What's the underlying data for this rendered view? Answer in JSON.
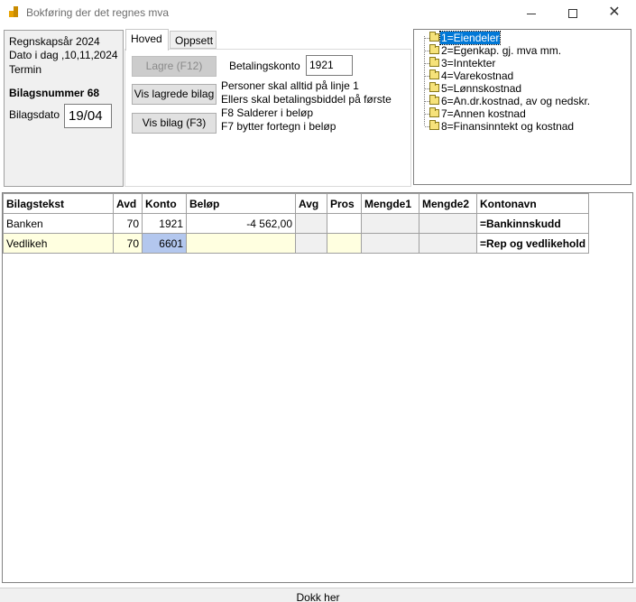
{
  "window": {
    "title": "Bokføring der det regnes mva"
  },
  "info": {
    "regnskapsar": "Regnskapsår 2024",
    "dato_idag": "Dato i dag ,10,11,2024",
    "termin": "Termin",
    "bilagsnummer": "Bilagsnummer 68",
    "bilagsdato_label": "Bilagsdato",
    "bilagsdato_value": "19/04"
  },
  "tabs": [
    {
      "label": "Hoved",
      "selected": true
    },
    {
      "label": "Oppsett",
      "selected": false
    }
  ],
  "hoved": {
    "lagre_label": "Lagre (F12)",
    "vis_lagrede_label": "Vis lagrede bilag",
    "vis_bilag_label": "Vis bilag  (F3)",
    "betalingskonto_label": "Betalingskonto",
    "betalingskonto_value": "1921",
    "info_lines": [
      "Personer skal alltid på linje 1",
      "Ellers skal betalingsbiddel på første",
      "F8 Salderer i beløp",
      "F7 bytter fortegn i beløp"
    ]
  },
  "tree": {
    "items": [
      "1=Eiendeler",
      "2=Egenkap. gj. mva mm.",
      "3=Inntekter",
      "4=Varekostnad",
      "5=Lønnskostnad",
      "6=An.dr.kostnad, av og nedskr.",
      "7=Annen kostnad",
      "8=Finansinntekt og kostnad"
    ],
    "selected_index": 0
  },
  "grid": {
    "headers": [
      "Bilagstekst",
      "Avd",
      "Konto",
      "Beløp",
      "Avg",
      "Pros",
      "Mengde1",
      "Mengde2",
      "Kontonavn"
    ],
    "rows": [
      [
        "Banken",
        "70",
        "1921",
        "-4 562,00",
        "",
        "",
        "",
        "",
        "=Bankinnskudd"
      ],
      [
        "Vedlikeh",
        "70",
        "6601",
        "",
        "",
        "",
        "",
        "",
        "=Rep og vedlikehold"
      ]
    ]
  },
  "footer": {
    "dock_label": "Dokk her"
  },
  "colors": {
    "selection": "#0078d7",
    "row_highlight": "#ffffe0",
    "cell_selected": "#b3c7ee"
  }
}
